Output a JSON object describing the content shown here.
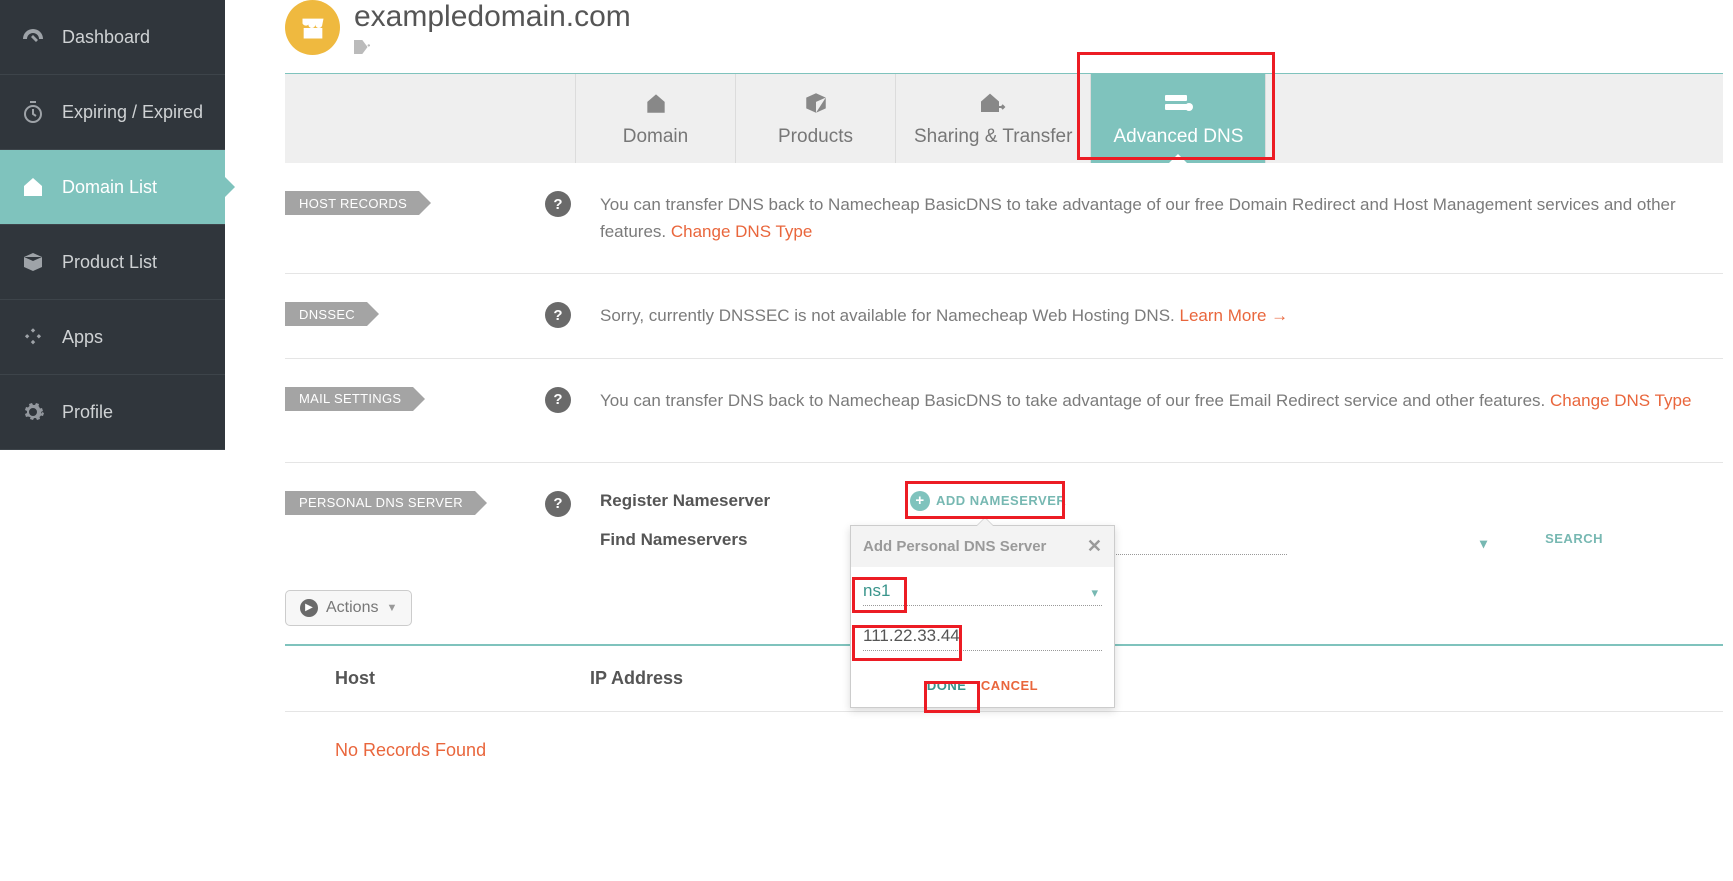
{
  "sidebar": {
    "items": [
      {
        "label": "Dashboard"
      },
      {
        "label": "Expiring / Expired"
      },
      {
        "label": "Domain List"
      },
      {
        "label": "Product List"
      },
      {
        "label": "Apps"
      },
      {
        "label": "Profile"
      }
    ]
  },
  "header": {
    "domain": "exampledomain.com"
  },
  "tabs": [
    {
      "label": "Domain"
    },
    {
      "label": "Products"
    },
    {
      "label": "Sharing & Transfer"
    },
    {
      "label": "Advanced DNS"
    }
  ],
  "sections": {
    "host_records": {
      "pill": "HOST RECORDS",
      "text": "You can transfer DNS back to Namecheap BasicDNS to take advantage of our free Domain Redirect and Host Management services and other features. ",
      "link": "Change DNS Type"
    },
    "dnssec": {
      "pill": "DNSSEC",
      "text": "Sorry, currently DNSSEC is not available for Namecheap Web Hosting DNS. ",
      "link": "Learn More →"
    },
    "mail": {
      "pill": "MAIL SETTINGS",
      "text": "You can transfer DNS back to Namecheap BasicDNS to take advantage of our free Email Redirect service and other features. ",
      "link": "Change DNS Type"
    },
    "pdns": {
      "pill": "PERSONAL DNS SERVER",
      "register_label": "Register Nameserver",
      "add_label": "ADD NAMESERVER",
      "find_label": "Find Nameservers",
      "search_label": "SEARCH"
    }
  },
  "actions_button": "Actions",
  "table": {
    "col1": "Host",
    "col2": "IP Address",
    "empty": "No Records Found"
  },
  "popover": {
    "title": "Add Personal DNS Server",
    "ns_value": "ns1",
    "ip_value": "111.22.33.44",
    "done": "DONE",
    "cancel": "CANCEL"
  },
  "colors": {
    "accent": "#7fc3bd",
    "link": "#e9663c",
    "highlight": "#ec1c24"
  }
}
